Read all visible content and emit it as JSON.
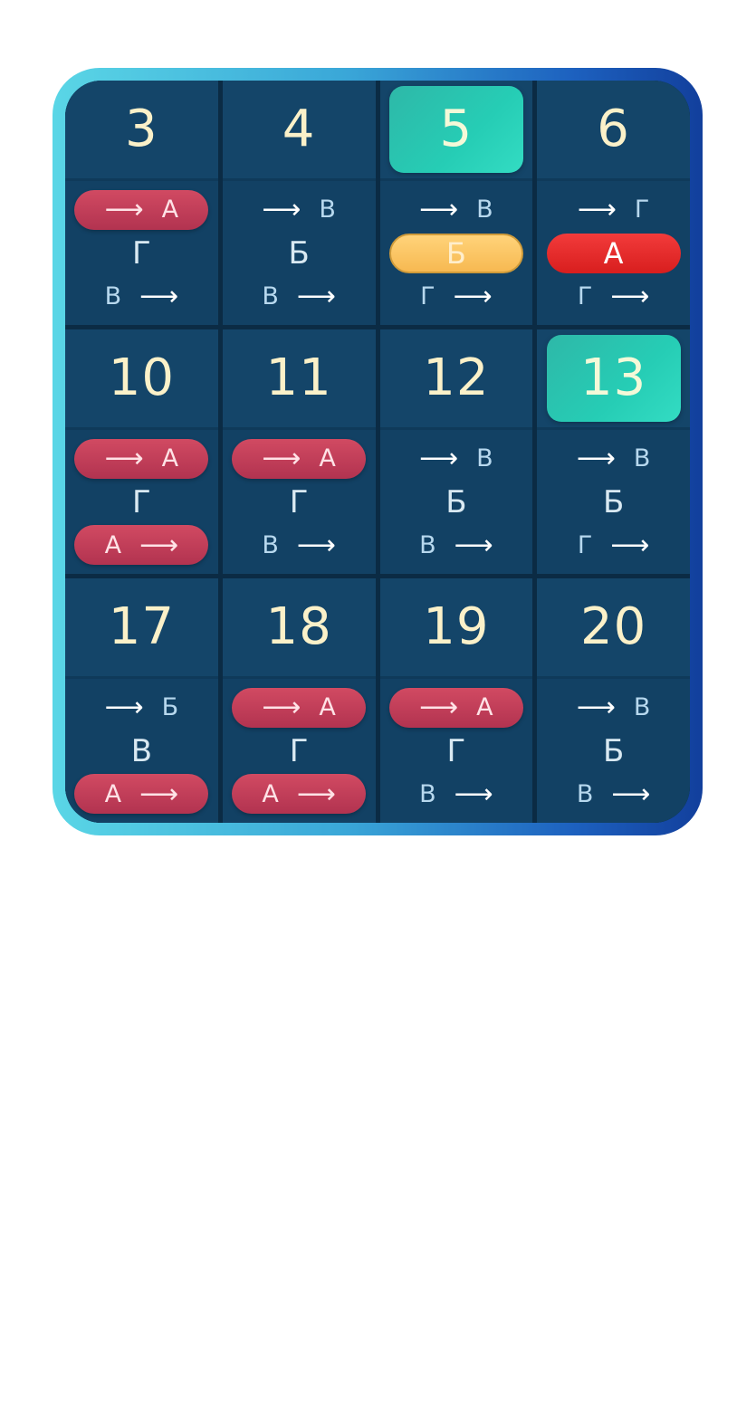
{
  "calendar": {
    "cells": [
      {
        "day": "3",
        "day_active": false,
        "top": {
          "style": "pill-red",
          "arrow": "left",
          "letter": "А"
        },
        "middle": {
          "style": "plain",
          "letter": "Г"
        },
        "bottom": {
          "style": "plain",
          "arrow": "right",
          "letter": "В"
        }
      },
      {
        "day": "4",
        "day_active": false,
        "top": {
          "style": "plain",
          "arrow": "left",
          "letter": "В"
        },
        "middle": {
          "style": "plain",
          "letter": "Б"
        },
        "bottom": {
          "style": "plain",
          "arrow": "right",
          "letter": "В"
        }
      },
      {
        "day": "5",
        "day_active": true,
        "top": {
          "style": "plain",
          "arrow": "left",
          "letter": "В"
        },
        "middle": {
          "style": "pill-yellow",
          "letter": "Б"
        },
        "bottom": {
          "style": "plain",
          "arrow": "right",
          "letter": "Г"
        }
      },
      {
        "day": "6",
        "day_active": false,
        "top": {
          "style": "plain",
          "arrow": "left",
          "letter": "Г"
        },
        "middle": {
          "style": "pill-bright",
          "letter": "А"
        },
        "bottom": {
          "style": "plain",
          "arrow": "right",
          "letter": "Г"
        }
      },
      {
        "day": "10",
        "day_active": false,
        "top": {
          "style": "pill-red",
          "arrow": "left",
          "letter": "А"
        },
        "middle": {
          "style": "plain",
          "letter": "Г"
        },
        "bottom": {
          "style": "pill-red",
          "arrow": "right",
          "letter": "А"
        }
      },
      {
        "day": "11",
        "day_active": false,
        "top": {
          "style": "pill-red",
          "arrow": "left",
          "letter": "А"
        },
        "middle": {
          "style": "plain",
          "letter": "Г"
        },
        "bottom": {
          "style": "plain",
          "arrow": "right",
          "letter": "В"
        }
      },
      {
        "day": "12",
        "day_active": false,
        "top": {
          "style": "plain",
          "arrow": "left",
          "letter": "В"
        },
        "middle": {
          "style": "plain",
          "letter": "Б"
        },
        "bottom": {
          "style": "plain",
          "arrow": "right",
          "letter": "В"
        }
      },
      {
        "day": "13",
        "day_active": true,
        "top": {
          "style": "plain",
          "arrow": "left",
          "letter": "В"
        },
        "middle": {
          "style": "plain",
          "letter": "Б"
        },
        "bottom": {
          "style": "plain",
          "arrow": "right",
          "letter": "Г"
        }
      },
      {
        "day": "17",
        "day_active": false,
        "top": {
          "style": "plain",
          "arrow": "left",
          "letter": "Б"
        },
        "middle": {
          "style": "plain",
          "letter": "В"
        },
        "bottom": {
          "style": "pill-red",
          "arrow": "right",
          "letter": "А"
        }
      },
      {
        "day": "18",
        "day_active": false,
        "top": {
          "style": "pill-red",
          "arrow": "left",
          "letter": "А"
        },
        "middle": {
          "style": "plain",
          "letter": "Г"
        },
        "bottom": {
          "style": "pill-red",
          "arrow": "right",
          "letter": "А"
        }
      },
      {
        "day": "19",
        "day_active": false,
        "top": {
          "style": "pill-red",
          "arrow": "left",
          "letter": "А"
        },
        "middle": {
          "style": "plain",
          "letter": "Г"
        },
        "bottom": {
          "style": "plain",
          "arrow": "right",
          "letter": "В"
        }
      },
      {
        "day": "20",
        "day_active": false,
        "top": {
          "style": "plain",
          "arrow": "left",
          "letter": "В"
        },
        "middle": {
          "style": "plain",
          "letter": "Б"
        },
        "bottom": {
          "style": "plain",
          "arrow": "right",
          "letter": "В"
        }
      }
    ]
  },
  "icons": {
    "arrow": "right-arrow-icon"
  },
  "colors": {
    "board_bg": "#0e3350",
    "active_day": "#26cdb5",
    "pill_red": "#c13e59",
    "pill_bright": "#e52b2b",
    "pill_yellow": "#fbc566",
    "day_text": "#fbf1c9"
  }
}
